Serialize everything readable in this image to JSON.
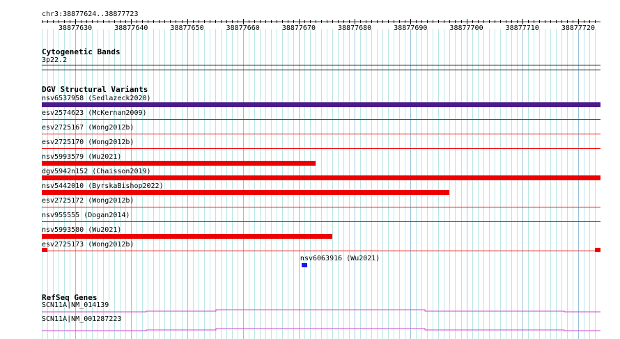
{
  "ruler": {
    "region": "chr3:38877624..38877723",
    "start": 38877624,
    "end": 38877723,
    "ticks": [
      "38877630",
      "38877640",
      "38877650",
      "38877660",
      "38877670",
      "38877680",
      "38877690",
      "38877700",
      "38877710",
      "38877720"
    ]
  },
  "cytobands": {
    "title": "Cytogenetic Bands",
    "band": "3p22.2"
  },
  "dgv": {
    "title": "DGV Structural Variants",
    "rows": [
      {
        "label": "nsv6537958 (Sedlazeck2020)",
        "color": "#4b1b8a",
        "start": 38877624,
        "end": 38877723
      },
      {
        "label": "esv2574623 (McKernan2009)",
        "color": "#ee0000"
      },
      {
        "label": "esv2725167 (Wong2012b)",
        "color": "#ee0000"
      },
      {
        "label": "esv2725170 (Wong2012b)",
        "color": "#ee0000"
      },
      {
        "label": "nsv5993579 (Wu2021)",
        "color": "#ee0000",
        "start": 38877624,
        "end": 38877672
      },
      {
        "label": "dgv5942n152 (Chaisson2019)",
        "color": "#ee0000",
        "start": 38877624,
        "end": 38877723
      },
      {
        "label": "nsv5442010 (ByrskaBishop2022)",
        "color": "#ee0000",
        "start": 38877624,
        "end": 38877696
      },
      {
        "label": "esv2725172 (Wong2012b)",
        "color": "#ee0000"
      },
      {
        "label": "nsv955555 (Dogan2014)",
        "color": "#ee0000"
      },
      {
        "label": "nsv5993580 (Wu2021)",
        "color": "#ee0000",
        "start": 38877624,
        "end": 38877675
      },
      {
        "label": "esv2725173 (Wong2012b)",
        "color": "#ee0000"
      }
    ],
    "extra": {
      "label": "nsv6063916 (Wu2021)",
      "color": "#1a1ae6",
      "start": 38877670.5,
      "end": 38877671.5
    }
  },
  "refseq": {
    "title": "RefSeq Genes",
    "genes": [
      {
        "label": "SCN11A|NM_014139"
      },
      {
        "label": "SCN11A|NM_001287223"
      }
    ],
    "color": "#cc44cc"
  }
}
